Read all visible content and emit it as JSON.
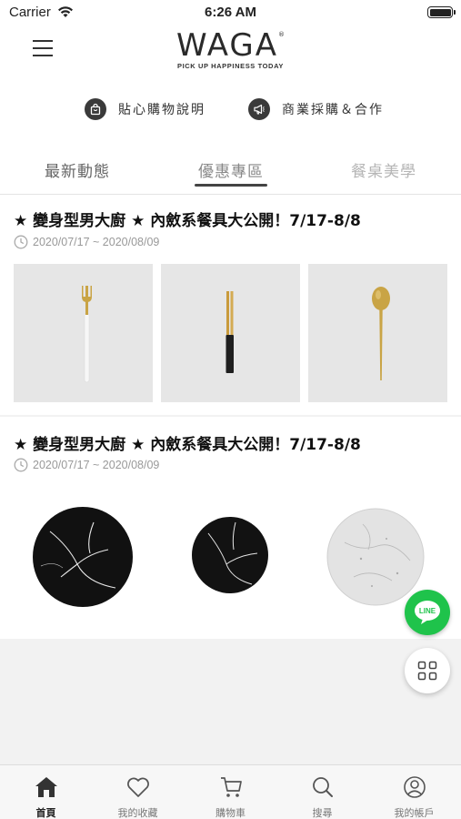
{
  "status_bar": {
    "carrier": "Carrier",
    "time": "6:26 AM"
  },
  "header": {
    "logo_text": "WAGA",
    "logo_reg": "®",
    "logo_tagline": "PICK UP HAPPINESS TODAY",
    "quick_links": [
      {
        "label": "貼心購物說明",
        "icon": "shopping-bag-icon"
      },
      {
        "label": "商業採購＆合作",
        "icon": "megaphone-icon"
      }
    ]
  },
  "tabs": [
    {
      "label": "最新動態",
      "active": false
    },
    {
      "label": "優惠專區",
      "active": true
    },
    {
      "label": "餐桌美學",
      "active": false
    }
  ],
  "promotions": [
    {
      "title": "★ 變身型男大廚 ★ 內斂系餐具大公開！7/17-8/8",
      "date": "2020/07/17 ~ 2020/08/09",
      "images": [
        "gold-fork-white-handle",
        "gold-chopsticks",
        "gold-spoon"
      ]
    },
    {
      "title": "★ 變身型男大廚 ★ 內斂系餐具大公開！7/17-8/8",
      "date": "2020/07/17 ~ 2020/08/09",
      "images": [
        "black-marble-plate-large",
        "black-marble-plate-small",
        "white-marble-plate"
      ]
    }
  ],
  "floating_buttons": {
    "line_label": "LINE",
    "grid": "grid-menu-icon"
  },
  "bottom_nav": [
    {
      "label": "首頁",
      "icon": "home-icon",
      "active": true
    },
    {
      "label": "我的收藏",
      "icon": "heart-icon",
      "active": false
    },
    {
      "label": "購物車",
      "icon": "cart-icon",
      "active": false
    },
    {
      "label": "搜尋",
      "icon": "search-icon",
      "active": false
    },
    {
      "label": "我的帳戶",
      "icon": "account-icon",
      "active": false
    }
  ],
  "colors": {
    "line_green": "#1fc34b",
    "text_dark": "#222222",
    "muted": "#999999"
  }
}
